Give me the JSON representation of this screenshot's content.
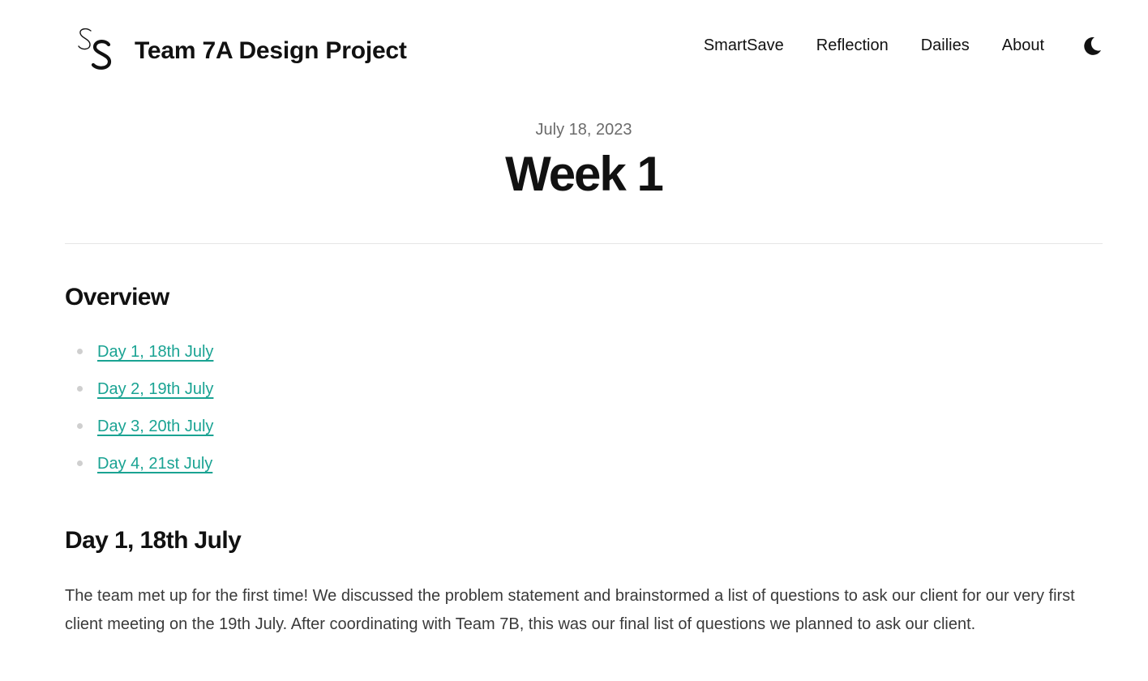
{
  "header": {
    "site_title": "Team 7A Design Project",
    "logo_icon": "ss-monogram-logo",
    "nav": [
      {
        "label": "SmartSave"
      },
      {
        "label": "Reflection"
      },
      {
        "label": "Dailies"
      },
      {
        "label": "About"
      }
    ],
    "theme_toggle_icon": "moon-icon"
  },
  "post": {
    "date": "July 18, 2023",
    "title": "Week 1"
  },
  "overview": {
    "heading": "Overview",
    "items": [
      {
        "label": "Day 1, 18th July"
      },
      {
        "label": "Day 2, 19th July"
      },
      {
        "label": "Day 3, 20th July"
      },
      {
        "label": "Day 4, 21st July"
      }
    ]
  },
  "day1": {
    "heading": "Day 1, 18th July",
    "paragraph": "The team met up for the first time! We discussed the problem statement and brainstormed a list of questions to ask our client for our very first client meeting on the 19th July. After coordinating with Team 7B, this was our final list of questions we planned to ask our client."
  },
  "colors": {
    "link": "#1aa393",
    "text": "#111111",
    "muted": "#6b6b6b",
    "body_text": "#3a3a3a",
    "divider": "#e6e6e6"
  }
}
